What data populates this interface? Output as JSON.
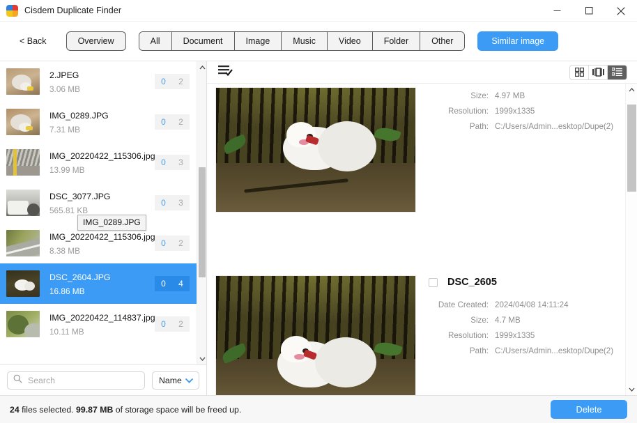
{
  "window": {
    "title": "Cisdem Duplicate Finder",
    "icon": "app-logo-icon",
    "controls": {
      "minimize": "minimize-icon",
      "maximize": "maximize-icon",
      "close": "close-icon"
    }
  },
  "toolbar": {
    "back_label": "< Back",
    "overview_label": "Overview",
    "tabs": [
      {
        "label": "All"
      },
      {
        "label": "Document"
      },
      {
        "label": "Image"
      },
      {
        "label": "Music"
      },
      {
        "label": "Video"
      },
      {
        "label": "Folder"
      },
      {
        "label": "Other"
      }
    ],
    "similar_image_label": "Similar image",
    "accent_color": "#3b9bf5"
  },
  "sidebar": {
    "files": [
      {
        "name": "2.JPEG",
        "size": "3.06 MB",
        "count_selected": "0",
        "count_total": "2",
        "selected": false
      },
      {
        "name": "IMG_0289.JPG",
        "size": "7.31 MB",
        "count_selected": "0",
        "count_total": "2",
        "selected": false
      },
      {
        "name": "IMG_20220422_115306.jpg",
        "size": "13.99 MB",
        "count_selected": "0",
        "count_total": "3",
        "selected": false
      },
      {
        "name": "DSC_3077.JPG",
        "size": "565.81 KB",
        "count_selected": "0",
        "count_total": "3",
        "selected": false
      },
      {
        "name": "IMG_20220422_115306.jpg",
        "size": "8.38 MB",
        "count_selected": "0",
        "count_total": "2",
        "selected": false
      },
      {
        "name": "DSC_2604.JPG",
        "size": "16.86 MB",
        "count_selected": "0",
        "count_total": "4",
        "selected": true
      },
      {
        "name": "IMG_20220422_114837.jpg",
        "size": "10.11 MB",
        "count_selected": "0",
        "count_total": "2",
        "selected": false
      }
    ],
    "tooltip": "IMG_0289.JPG",
    "scrollbar": {
      "up_icon": "chevron-up-icon",
      "down_icon": "chevron-down-icon"
    }
  },
  "search": {
    "placeholder": "Search",
    "value": "",
    "icon": "search-icon",
    "sort_value": "Name",
    "sort_icon": "chevron-down-icon"
  },
  "content": {
    "header_icon": "list-check-icon",
    "view_modes": [
      {
        "icon": "grid-view-icon",
        "active": false
      },
      {
        "icon": "carousel-view-icon",
        "active": false
      },
      {
        "icon": "list-view-icon",
        "active": true
      }
    ],
    "entries": [
      {
        "title": "",
        "photo": "samoyed-dogs-forest-photo",
        "fields": [
          {
            "label": "Size:",
            "value": "4.97 MB"
          },
          {
            "label": "Resolution:",
            "value": "1999x1335"
          },
          {
            "label": "Path:",
            "value": "C:/Users/Admin...esktop/Dupe(2)"
          }
        ]
      },
      {
        "title": "DSC_2605",
        "photo": "samoyed-dogs-forest-photo",
        "fields": [
          {
            "label": "Date Created:",
            "value": "2024/04/08 14:11:24"
          },
          {
            "label": "Size:",
            "value": "4.7 MB"
          },
          {
            "label": "Resolution:",
            "value": "1999x1335"
          },
          {
            "label": "Path:",
            "value": "C:/Users/Admin...esktop/Dupe(2)"
          }
        ]
      }
    ],
    "scrollbar": {
      "up_icon": "chevron-up-icon",
      "down_icon": "chevron-down-icon"
    }
  },
  "status": {
    "count": "24",
    "text_mid": "files selected.",
    "size": "99.87 MB",
    "text_end": "of storage space will be freed up.",
    "delete_label": "Delete"
  }
}
